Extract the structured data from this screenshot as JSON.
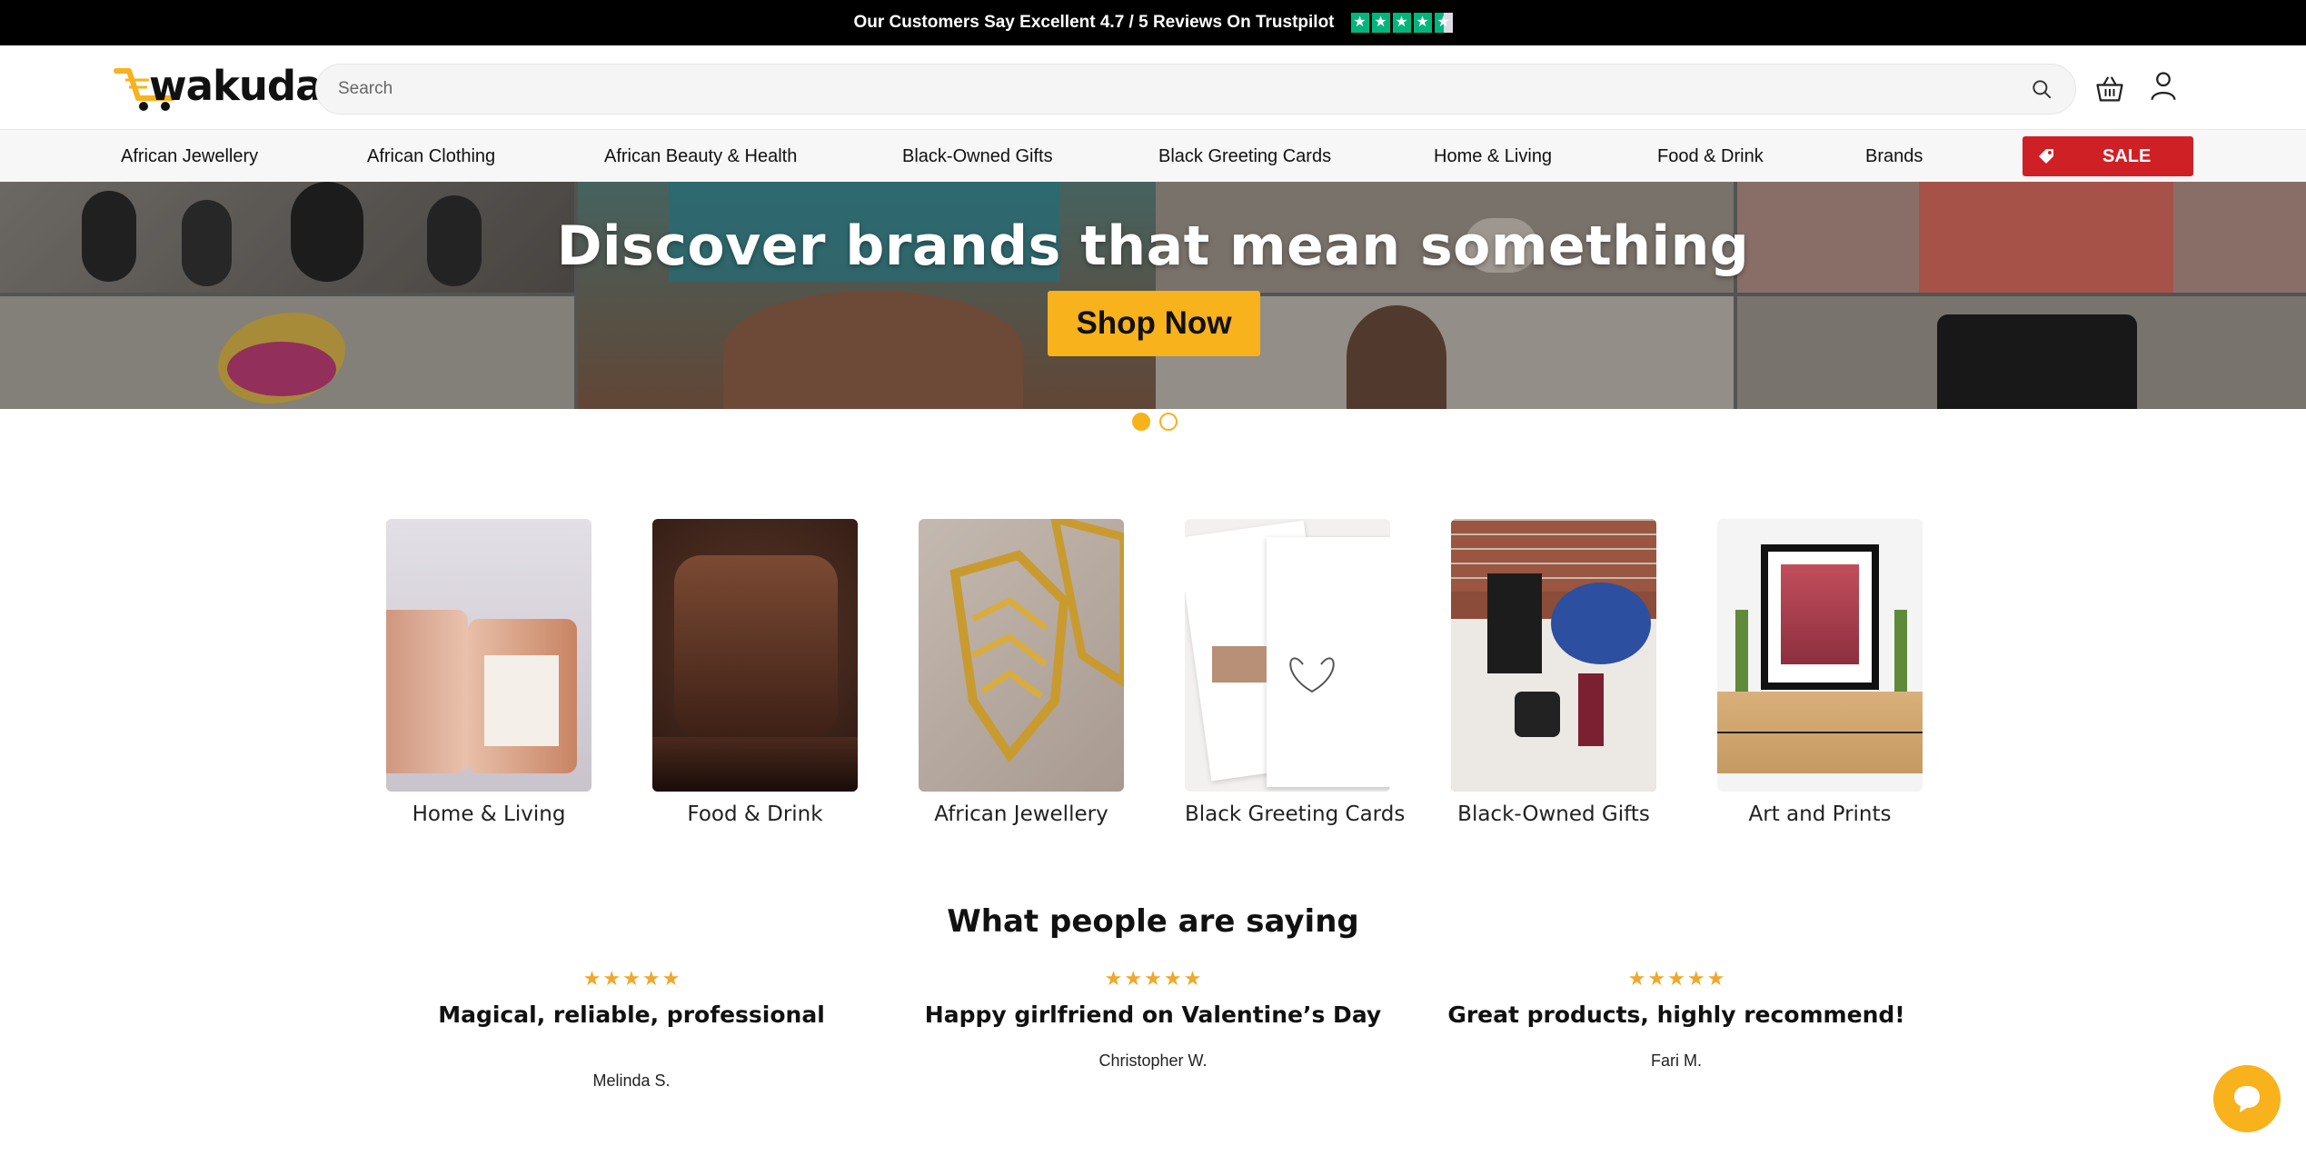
{
  "topbar": {
    "text": "Our Customers Say Excellent 4.7 / 5 Reviews On Trustpilot",
    "trustpilot_rating": 4.5,
    "trustpilot_color": "#00b67a"
  },
  "header": {
    "logo_text": "wakuda",
    "search_placeholder": "Search",
    "icons": [
      "search-icon",
      "basket-icon",
      "user-icon"
    ]
  },
  "nav": {
    "items": [
      "African Jewellery",
      "African Clothing",
      "African Beauty & Health",
      "Black-Owned Gifts",
      "Black Greeting Cards",
      "Home & Living",
      "Food & Drink",
      "Brands"
    ],
    "sale_label": "SALE",
    "sale_color": "#cf2026"
  },
  "hero": {
    "title": "Discover brands that mean something",
    "button_label": "Shop Now",
    "button_color": "#f7b21c",
    "slides": 2,
    "active_slide": 1
  },
  "categories": [
    {
      "label": "Home & Living"
    },
    {
      "label": "Food & Drink"
    },
    {
      "label": "African Jewellery"
    },
    {
      "label": "Black Greeting Cards"
    },
    {
      "label": "Black-Owned Gifts"
    },
    {
      "label": "Art and Prints"
    }
  ],
  "reviews": {
    "heading": "What people are saying",
    "star_color": "#f0a82b",
    "items": [
      {
        "rating": 5,
        "title": "Magical, reliable, professional",
        "author": "Melinda S."
      },
      {
        "rating": 5,
        "title": "Happy girlfriend on Valentine’s Day",
        "author": "Christopher W."
      },
      {
        "rating": 5,
        "title": "Great products, highly recommend!",
        "author": "Fari M."
      }
    ]
  },
  "chat": {
    "icon": "chat-bubble-icon"
  }
}
